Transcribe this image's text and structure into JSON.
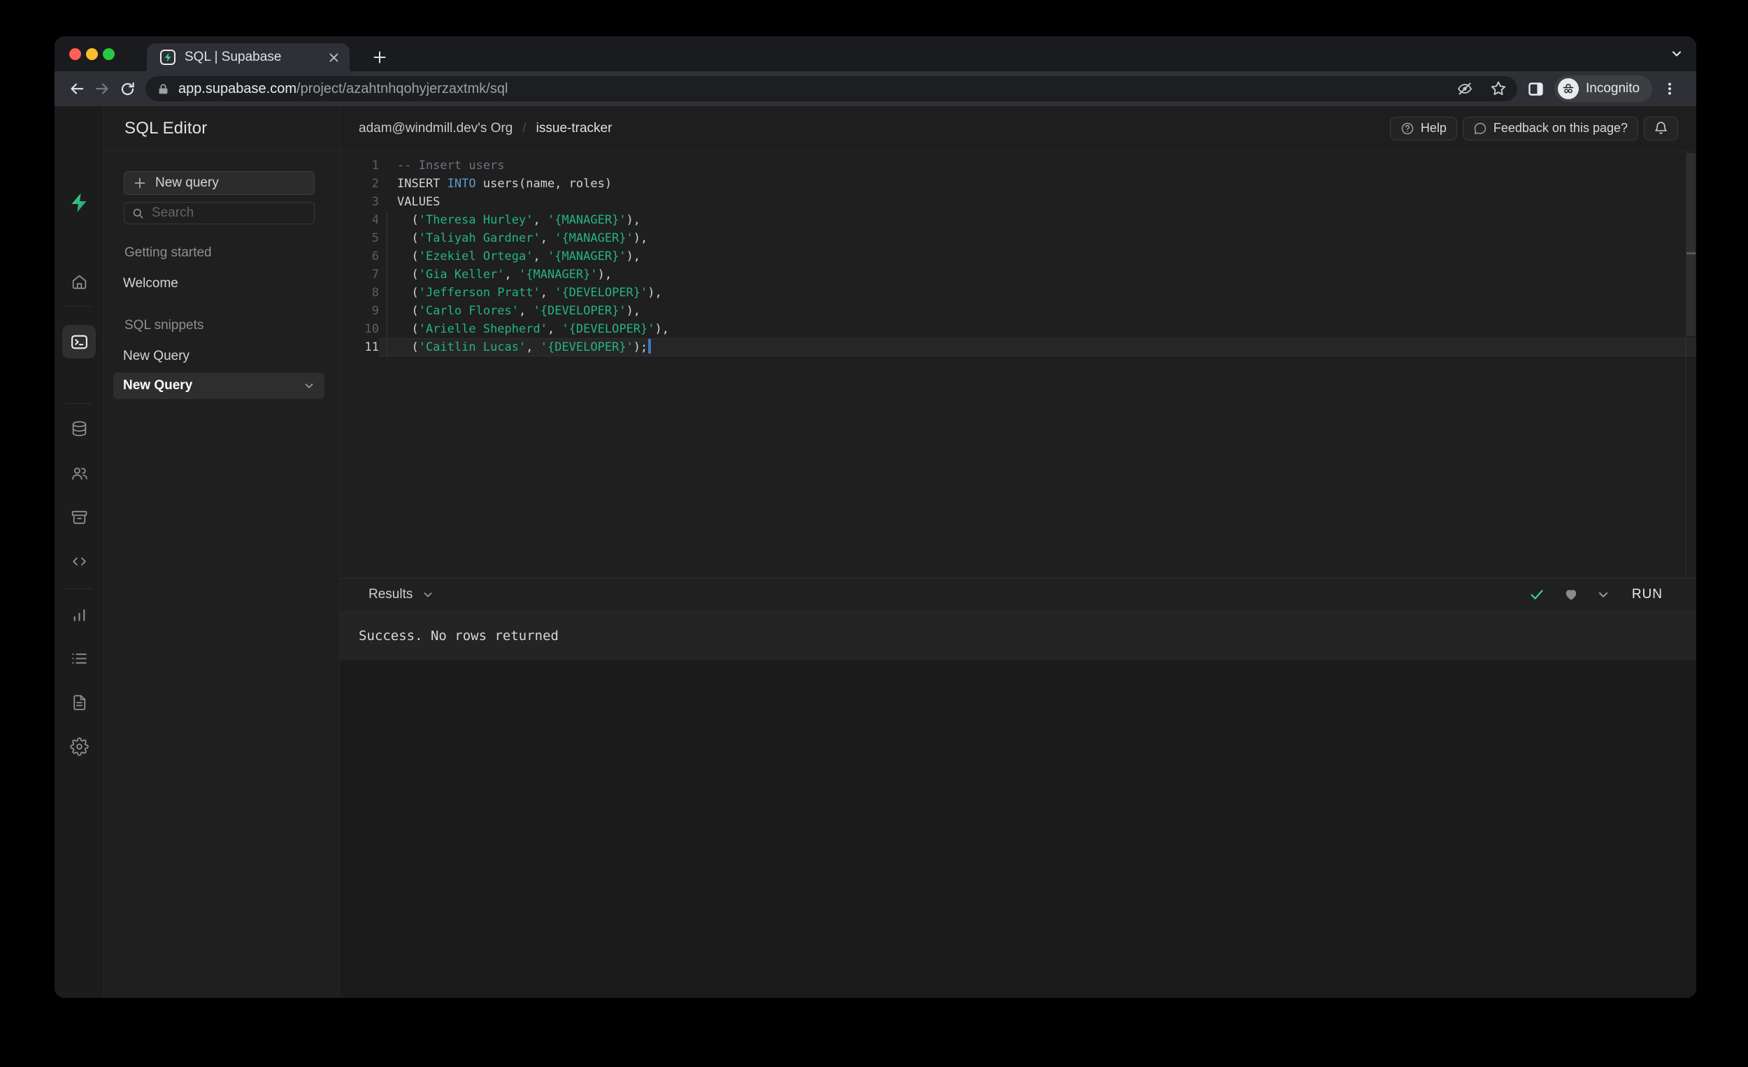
{
  "browser": {
    "tab_title": "SQL | Supabase",
    "url": {
      "domain": "app.supabase.com",
      "path": "/project/azahtnhqohyjerzaxtmk/sql"
    },
    "incognito_label": "Incognito"
  },
  "app_header": {
    "org": "adam@windmill.dev's Org",
    "separator": "/",
    "project": "issue-tracker",
    "help": "Help",
    "feedback": "Feedback on this page?"
  },
  "sidebar": {
    "title": "SQL Editor",
    "new_query": "New query",
    "search_placeholder": "Search",
    "sections": [
      {
        "label": "Getting started",
        "items": [
          {
            "label": "Welcome",
            "active": false
          }
        ]
      },
      {
        "label": "SQL snippets",
        "items": [
          {
            "label": "New Query",
            "active": false
          },
          {
            "label": "New Query",
            "active": true
          }
        ]
      }
    ]
  },
  "rail_items": [
    "supabase-logo",
    "home",
    "table-editor",
    "sql-editor",
    "database",
    "authentication",
    "storage",
    "edge-functions",
    "reports",
    "logs",
    "docs",
    "settings",
    "account"
  ],
  "editor": {
    "lines": [
      {
        "num": 1,
        "parts": [
          [
            "comment",
            "-- Insert users"
          ]
        ]
      },
      {
        "num": 2,
        "parts": [
          [
            "plain",
            "INSERT "
          ],
          [
            "keyword",
            "INTO"
          ],
          [
            "plain",
            " users(name, roles)"
          ]
        ]
      },
      {
        "num": 3,
        "parts": [
          [
            "plain",
            "VALUES"
          ]
        ]
      },
      {
        "num": 4,
        "guide": true,
        "parts": [
          [
            "plain",
            "  ("
          ],
          [
            "string",
            "'Theresa Hurley'"
          ],
          [
            "plain",
            ", "
          ],
          [
            "string",
            "'{MANAGER}'"
          ],
          [
            "plain",
            "),"
          ]
        ]
      },
      {
        "num": 5,
        "guide": true,
        "parts": [
          [
            "plain",
            "  ("
          ],
          [
            "string",
            "'Taliyah Gardner'"
          ],
          [
            "plain",
            ", "
          ],
          [
            "string",
            "'{MANAGER}'"
          ],
          [
            "plain",
            "),"
          ]
        ]
      },
      {
        "num": 6,
        "guide": true,
        "parts": [
          [
            "plain",
            "  ("
          ],
          [
            "string",
            "'Ezekiel Ortega'"
          ],
          [
            "plain",
            ", "
          ],
          [
            "string",
            "'{MANAGER}'"
          ],
          [
            "plain",
            "),"
          ]
        ]
      },
      {
        "num": 7,
        "guide": true,
        "parts": [
          [
            "plain",
            "  ("
          ],
          [
            "string",
            "'Gia Keller'"
          ],
          [
            "plain",
            ", "
          ],
          [
            "string",
            "'{MANAGER}'"
          ],
          [
            "plain",
            "),"
          ]
        ]
      },
      {
        "num": 8,
        "guide": true,
        "parts": [
          [
            "plain",
            "  ("
          ],
          [
            "string",
            "'Jefferson Pratt'"
          ],
          [
            "plain",
            ", "
          ],
          [
            "string",
            "'{DEVELOPER}'"
          ],
          [
            "plain",
            "),"
          ]
        ]
      },
      {
        "num": 9,
        "guide": true,
        "parts": [
          [
            "plain",
            "  ("
          ],
          [
            "string",
            "'Carlo Flores'"
          ],
          [
            "plain",
            ", "
          ],
          [
            "string",
            "'{DEVELOPER}'"
          ],
          [
            "plain",
            "),"
          ]
        ]
      },
      {
        "num": 10,
        "guide": true,
        "parts": [
          [
            "plain",
            "  ("
          ],
          [
            "string",
            "'Arielle Shepherd'"
          ],
          [
            "plain",
            ", "
          ],
          [
            "string",
            "'{DEVELOPER}'"
          ],
          [
            "plain",
            "),"
          ]
        ]
      },
      {
        "num": 11,
        "guide": true,
        "current": true,
        "cursor": true,
        "parts": [
          [
            "plain",
            "  ("
          ],
          [
            "string",
            "'Caitlin Lucas'"
          ],
          [
            "plain",
            ", "
          ],
          [
            "string",
            "'{DEVELOPER}'"
          ],
          [
            "plain",
            ");"
          ]
        ]
      }
    ]
  },
  "results": {
    "label": "Results",
    "run": "RUN",
    "status": "Success. No rows returned"
  },
  "colors": {
    "brand_green": "#3ecf8e",
    "string_green": "#24b47e",
    "keyword_blue": "#569cd6",
    "comment_gray": "#6b7280",
    "success_check": "#3ecf8e",
    "traffic_red": "#ff5f57",
    "traffic_yellow": "#febc2e",
    "traffic_green": "#28c840"
  }
}
